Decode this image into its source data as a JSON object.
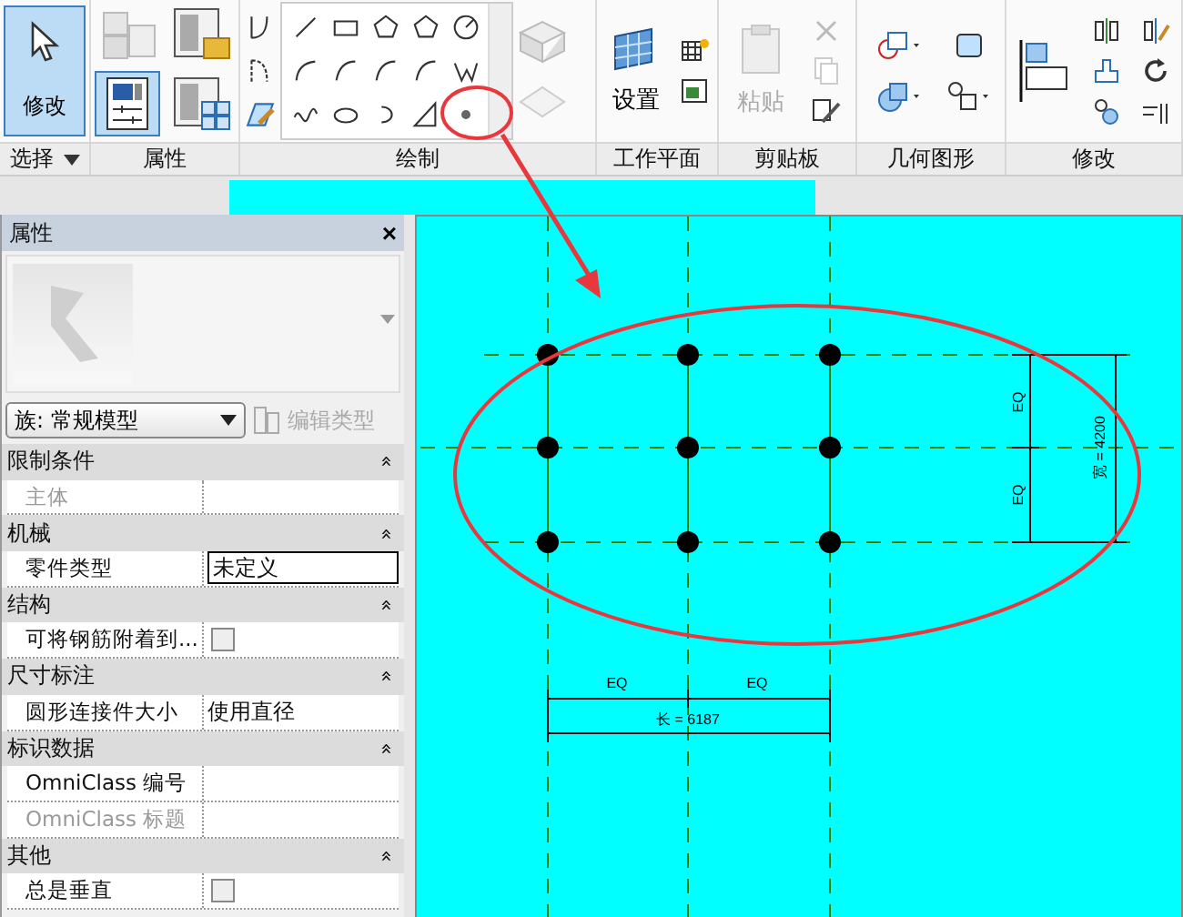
{
  "ribbon": {
    "modify": {
      "label": "修改",
      "selected": true
    },
    "properties_toggle": {
      "selected": true
    },
    "workplane_set": {
      "label": "设置"
    },
    "paste": {
      "label": "粘贴",
      "disabled": true
    },
    "panel_titles": [
      {
        "label": "选择",
        "dropdown": true
      },
      {
        "label": "属性",
        "dropdown": false
      },
      {
        "label": "绘制",
        "dropdown": false
      },
      {
        "label": "工作平面",
        "dropdown": false
      },
      {
        "label": "剪贴板",
        "dropdown": false
      },
      {
        "label": "几何图形",
        "dropdown": false
      },
      {
        "label": "修改",
        "dropdown": false
      }
    ]
  },
  "properties": {
    "title": "属性",
    "close": "×",
    "type_selector": "族: 常规模型",
    "edit_type": {
      "label": "编辑类型",
      "disabled": true
    },
    "groups": [
      {
        "name": "限制条件",
        "collapse": "«",
        "rows": [
          {
            "kind": "text",
            "label": "主体",
            "disabled": true
          }
        ]
      },
      {
        "name": "机械",
        "collapse": "«",
        "rows": [
          {
            "kind": "field",
            "label": "零件类型",
            "value": "未定义",
            "disabled": false
          }
        ]
      },
      {
        "name": "结构",
        "collapse": "«",
        "rows": [
          {
            "kind": "checkbox",
            "label": "可将钢筋附着到...",
            "checked": false,
            "disabled": false
          }
        ]
      },
      {
        "name": "尺寸标注",
        "collapse": "«",
        "rows": [
          {
            "kind": "text",
            "label": "圆形连接件大小",
            "value": "使用直径",
            "disabled": false
          }
        ]
      },
      {
        "name": "标识数据",
        "collapse": "«",
        "rows": [
          {
            "kind": "text",
            "label": "OmniClass 编号",
            "disabled": false
          },
          {
            "kind": "text",
            "label": "OmniClass 标题",
            "disabled": true
          }
        ]
      },
      {
        "name": "其他",
        "collapse": "«",
        "rows": [
          {
            "kind": "checkbox",
            "label": "总是垂直",
            "checked": false,
            "disabled": false
          }
        ]
      }
    ]
  },
  "canvas": {
    "dimensions": {
      "vertical": {
        "segments": [
          "EQ",
          "EQ"
        ],
        "total": "宽 = 4200"
      },
      "horizontal": {
        "segments": [
          "EQ",
          "EQ"
        ],
        "total": "长 = 6187"
      }
    }
  }
}
